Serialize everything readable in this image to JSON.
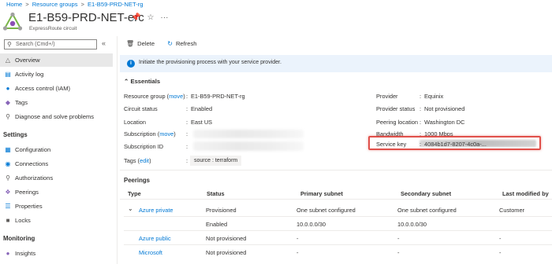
{
  "breadcrumb": {
    "home": "Home",
    "resource_groups": "Resource groups",
    "rg": "E1-B59-PRD-NET-rg",
    "sep": ">"
  },
  "header": {
    "title": "E1-B59-PRD-NET-erc",
    "subtitle": "ExpressRoute circuit",
    "pin_icon": "pin-icon",
    "star_icon": "star-icon",
    "more": "···"
  },
  "sidebar": {
    "search_placeholder": "Search (Cmd+/)",
    "collapse": "«",
    "items": [
      {
        "label": "Overview",
        "icon": "triangle-icon",
        "selected": true
      },
      {
        "label": "Activity log",
        "icon": "log-icon"
      },
      {
        "label": "Access control (IAM)",
        "icon": "people-icon"
      },
      {
        "label": "Tags",
        "icon": "tag-icon"
      },
      {
        "label": "Diagnose and solve problems",
        "icon": "wrench-icon"
      }
    ],
    "settings_header": "Settings",
    "settings_items": [
      {
        "label": "Configuration",
        "icon": "config-icon"
      },
      {
        "label": "Connections",
        "icon": "connections-icon"
      },
      {
        "label": "Authorizations",
        "icon": "key-icon"
      },
      {
        "label": "Peerings",
        "icon": "peerings-icon"
      },
      {
        "label": "Properties",
        "icon": "properties-icon"
      },
      {
        "label": "Locks",
        "icon": "lock-icon"
      }
    ],
    "monitoring_header": "Monitoring",
    "monitoring_items": [
      {
        "label": "Insights",
        "icon": "insights-icon"
      }
    ]
  },
  "toolbar": {
    "delete_label": "Delete",
    "refresh_label": "Refresh"
  },
  "banner": {
    "text": "Initiate the provisioning process with your service provider."
  },
  "essentials": {
    "header": "Essentials",
    "resource_group_label": "Resource group",
    "move_link": "move",
    "resource_group_value": "E1-B59-PRD-NET-rg",
    "circuit_status_label": "Circuit status",
    "circuit_status_value": "Enabled",
    "location_label": "Location",
    "location_value": "East US",
    "subscription_label": "Subscription",
    "subscription_id_label": "Subscription ID",
    "tags_label": "Tags",
    "edit_link": "edit",
    "tag_chip": "source : terraform",
    "provider_label": "Provider",
    "provider_value": "Equinix",
    "provider_status_label": "Provider status",
    "provider_status_value": "Not provisioned",
    "peering_location_label": "Peering location",
    "peering_location_value": "Washington DC",
    "bandwidth_label": "Bandwidth",
    "bandwidth_value": "1000 Mbps",
    "service_key_label": "Service key",
    "service_key_value": "4084b1d7-8207-4c0a-..."
  },
  "peerings": {
    "header": "Peerings",
    "columns": [
      "Type",
      "Status",
      "Primary subnet",
      "Secondary subnet",
      "Last modified by"
    ],
    "rows": [
      {
        "type": "Azure private",
        "status": "Provisioned",
        "primary": "One subnet configured",
        "secondary": "One subnet configured",
        "modified": "Customer"
      },
      {
        "type": "",
        "status": "Enabled",
        "primary": "10.0.0.0/30",
        "secondary": "10.0.0.0/30",
        "modified": ""
      },
      {
        "type": "Azure public",
        "status": "Not provisioned",
        "primary": "-",
        "secondary": "-",
        "modified": "-"
      },
      {
        "type": "Microsoft",
        "status": "Not provisioned",
        "primary": "-",
        "secondary": "-",
        "modified": "-"
      }
    ]
  }
}
